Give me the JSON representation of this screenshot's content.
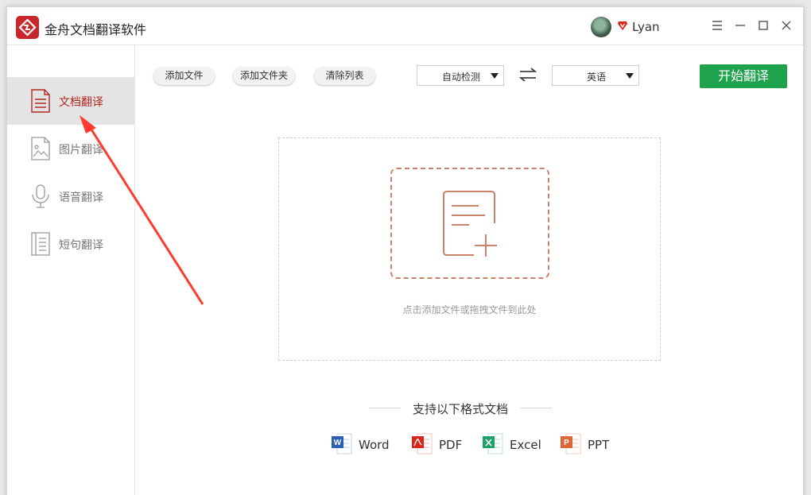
{
  "app": {
    "title": "金舟文档翻译软件",
    "brand_color": "#c8262a"
  },
  "user": {
    "name": "Lyan"
  },
  "window_controls": [
    "menu-icon",
    "minimize-icon",
    "maximize-icon",
    "close-icon"
  ],
  "sidebar": {
    "items": [
      {
        "label": "文档翻译",
        "icon": "document-icon",
        "active": true
      },
      {
        "label": "图片翻译",
        "icon": "image-icon",
        "active": false
      },
      {
        "label": "语音翻译",
        "icon": "microphone-icon",
        "active": false
      },
      {
        "label": "短句翻译",
        "icon": "sentence-icon",
        "active": false
      }
    ]
  },
  "toolbar": {
    "add_file": "添加文件",
    "add_folder": "添加文件夹",
    "clear_list": "清除列表",
    "source_lang": "自动检测",
    "target_lang": "英语",
    "start": "开始翻译",
    "start_color": "#1ea24b"
  },
  "dropzone": {
    "hint": "点击添加文件或拖拽文件到此处"
  },
  "formats": {
    "title": "支持以下格式文档",
    "items": [
      {
        "name": "Word",
        "icon": "word-icon",
        "color": "#2b5fb3"
      },
      {
        "name": "PDF",
        "icon": "pdf-icon",
        "color": "#d9261c"
      },
      {
        "name": "Excel",
        "icon": "excel-icon",
        "color": "#1ea16b"
      },
      {
        "name": "PPT",
        "icon": "ppt-icon",
        "color": "#e0663a"
      }
    ]
  },
  "accent_color": "#b4271f"
}
